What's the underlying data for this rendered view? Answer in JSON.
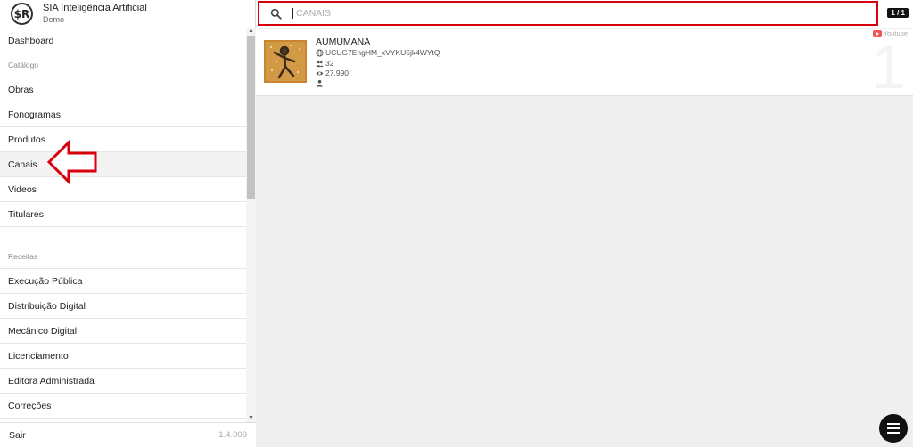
{
  "app": {
    "name": "SIA Inteligência Artificial",
    "tenant": "Demo",
    "logo_text": "$R"
  },
  "sidebar": {
    "items": [
      {
        "type": "item",
        "label": "Dashboard"
      },
      {
        "type": "section",
        "label": "Catálogo"
      },
      {
        "type": "item",
        "label": "Obras"
      },
      {
        "type": "item",
        "label": "Fonogramas"
      },
      {
        "type": "item",
        "label": "Produtos"
      },
      {
        "type": "item",
        "label": "Canais",
        "active": true
      },
      {
        "type": "item",
        "label": "Videos"
      },
      {
        "type": "item",
        "label": "Titulares"
      },
      {
        "type": "section",
        "label": "Receitas"
      },
      {
        "type": "item",
        "label": "Execução Pública"
      },
      {
        "type": "item",
        "label": "Distribuição Digital"
      },
      {
        "type": "item",
        "label": "Mecânico Digital"
      },
      {
        "type": "item",
        "label": "Licenciamento"
      },
      {
        "type": "item",
        "label": "Editora Administrada"
      },
      {
        "type": "item",
        "label": "Correções"
      }
    ],
    "footer": {
      "logout_label": "Sair",
      "version": "1.4.009"
    }
  },
  "search": {
    "placeholder": "CANAIS",
    "value": "",
    "pager": "1 / 1"
  },
  "results": [
    {
      "name": "AUMUMANA",
      "channel_id": "UCUG7EngHM_xVYKU5jk4WYtQ",
      "subscribers": "32",
      "views": "27.990",
      "owner": "",
      "platform": "Youtube",
      "index": "1"
    }
  ],
  "icons": {
    "search": "search-icon",
    "globe": "globe-icon",
    "people": "people-icon",
    "eye": "eye-icon",
    "person": "person-icon",
    "menu": "menu-icon",
    "youtube": "youtube-icon"
  },
  "colors": {
    "highlight": "#d9000d",
    "accent_dark": "#111111"
  }
}
